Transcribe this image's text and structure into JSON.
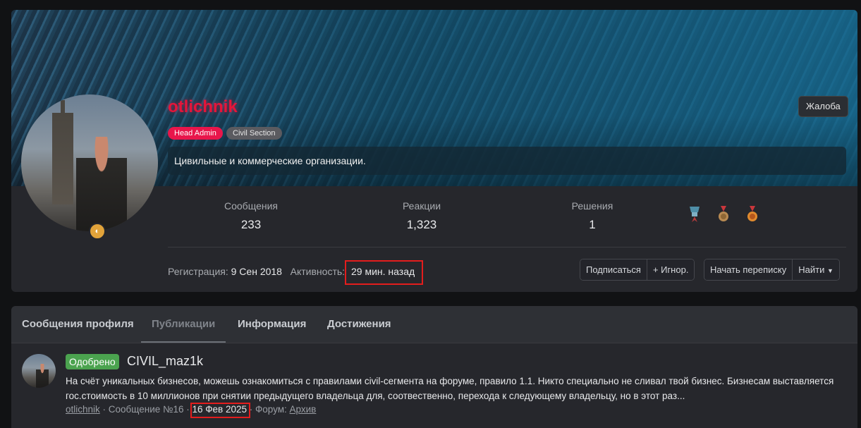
{
  "profile": {
    "username": "otlichnik",
    "badges": [
      "Head Admin",
      "Civil Section"
    ],
    "complaint_label": "Жалоба",
    "about": "Цивильные и коммерческие организации.",
    "stats": [
      {
        "label": "Сообщения",
        "value": "233"
      },
      {
        "label": "Реакции",
        "value": "1,323"
      },
      {
        "label": "Решения",
        "value": "1"
      }
    ],
    "trophies": [
      "trophy-silver-icon",
      "trophy-bronze-medal-icon",
      "trophy-gold-medal-icon"
    ],
    "registration_label": "Регистрация:",
    "registration_value": "9 Сен 2018",
    "activity_label": "Активность:",
    "activity_value": "29 мин. назад",
    "actions": {
      "subscribe": "Подписаться",
      "ignore": "+ Игнор.",
      "start_conversation": "Начать переписку",
      "find": "Найти"
    }
  },
  "tabs": [
    "Сообщения профиля",
    "Публикации",
    "Информация",
    "Достижения"
  ],
  "active_tab": "Публикации",
  "post": {
    "status": "Одобрено",
    "title": "CIVIL_maz1k",
    "snippet": "На счёт уникальных бизнесов, можешь ознакомиться с правилами civil-сегмента на форуме, правило 1.1. Никто специально не сливал твой бизнес. Бизнесам выставляется гос.стоимость в 10 миллионов при снятии предыдущего владельца для, соотвественно, перехода к следующему владельцу, но в этот раз...",
    "author": "otlichnik",
    "message_ref": "Сообщение №16",
    "date": "16 Фев 2025",
    "forum_label": "Форум:",
    "forum": "Архив"
  },
  "colors": {
    "username": "#e5153a",
    "badge_admin": "#e8164b",
    "approved": "#4ba34f",
    "highlight": "#e31d1d"
  }
}
